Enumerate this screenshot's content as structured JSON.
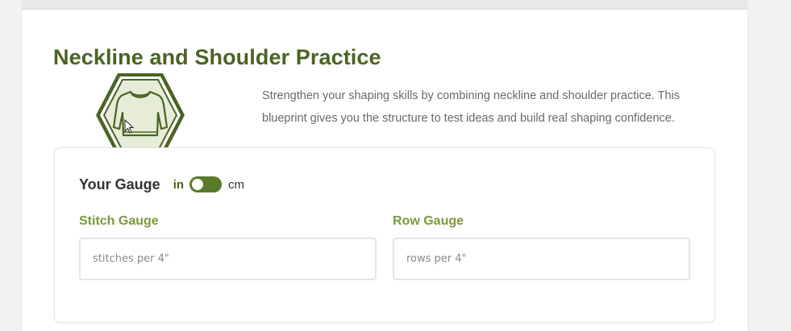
{
  "page": {
    "title": "Neckline and Shoulder Practice",
    "intro": "Strengthen your shaping skills by combining neckline and shoulder practice. This blueprint gives you the structure to test ideas and build real shaping confidence.",
    "badge_icon": "sweater-icon"
  },
  "gauge": {
    "title": "Your Gauge",
    "unit_left": "in",
    "unit_right": "cm",
    "stitch_label": "Stitch Gauge",
    "stitch_placeholder": "stitches per 4\"",
    "row_label": "Row Gauge",
    "row_placeholder": "rows per 4\""
  },
  "colors": {
    "title_green": "#4a6424",
    "label_green": "#7a9a3c",
    "toggle_green": "#5a7a2d",
    "badge_fill": "#e6ecd8",
    "badge_stroke": "#4a6424"
  }
}
